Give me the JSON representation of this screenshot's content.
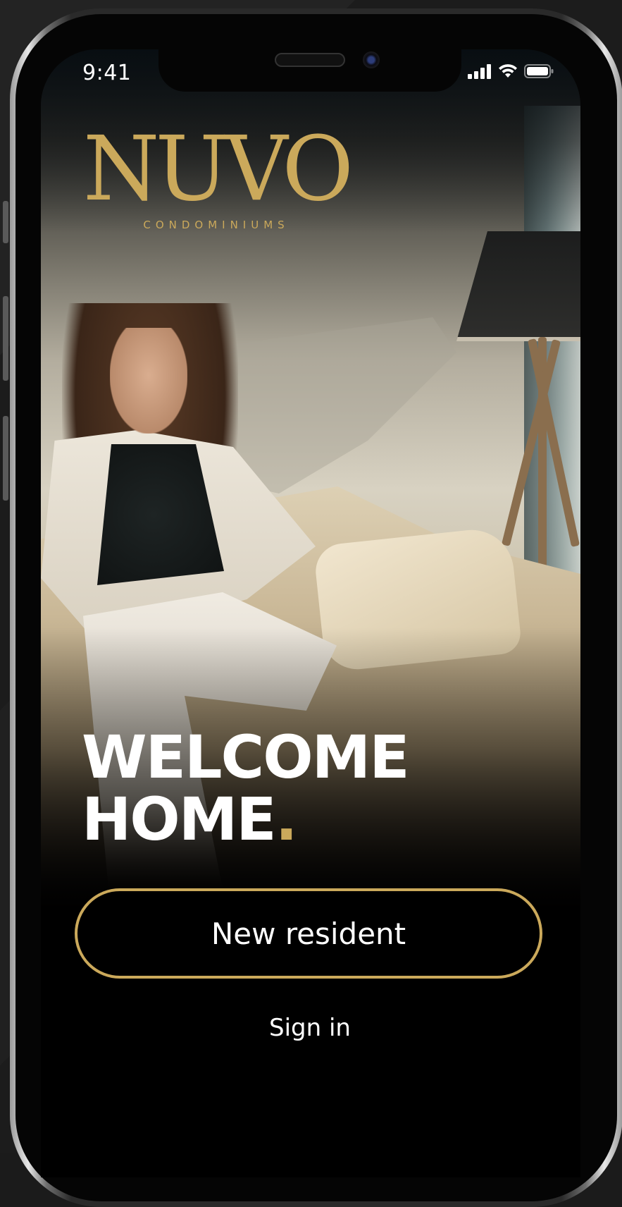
{
  "status_bar": {
    "time": "9:41",
    "icons": [
      "cellular-signal-icon",
      "wifi-icon",
      "battery-icon"
    ]
  },
  "brand": {
    "logo_text": "NUVO",
    "tagline": "CONDOMINIUMS",
    "accent_color": "#cba95b"
  },
  "hero": {
    "background": "photo of a woman seated on a cream sofa beside a tripod floor lamp"
  },
  "headline": {
    "line1": "WELCOME",
    "line2": "HOME",
    "punctuation": "."
  },
  "actions": {
    "new_resident_label": "New resident",
    "sign_in_label": "Sign in"
  }
}
